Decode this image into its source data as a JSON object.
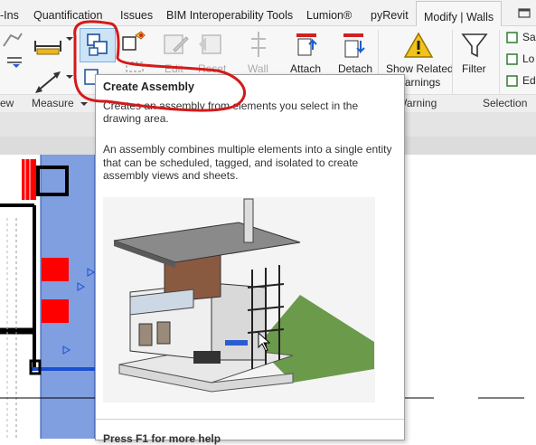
{
  "tabs": [
    {
      "label": "-Ins"
    },
    {
      "label": "Quantification"
    },
    {
      "label": "Issues"
    },
    {
      "label": "BIM Interoperability Tools"
    },
    {
      "label": "Lumion®"
    },
    {
      "label": "pyRevit"
    },
    {
      "label": "Modify | Walls"
    }
  ],
  "ribbon": {
    "buttons": {
      "edit": "Edit",
      "reset": "Reset",
      "wall": "Wall",
      "attach": "Attach",
      "detach": "Detach",
      "show_related_line1": "Show Related",
      "show_related_line2": "Warnings",
      "filter": "Filter",
      "sa": "Sa",
      "lo": "Lo",
      "ed": "Ed"
    },
    "panels": {
      "view": "ew",
      "measure": "Measure",
      "warning": "Warning",
      "selection": "Selection"
    }
  },
  "tooltip": {
    "title": "Create Assembly",
    "description": "Creates an assembly from elements you select in the drawing area.",
    "details": "An assembly combines multiple elements into a single entity that can be scheduled, tagged, and isolated to create assembly views and sheets.",
    "help": "Press F1 for more help"
  },
  "colors": {
    "annotation": "#d41a1a",
    "wall_fill": "#7f9fe0",
    "red_block": "#ff0000",
    "accent_blue": "#1a5fd0"
  }
}
